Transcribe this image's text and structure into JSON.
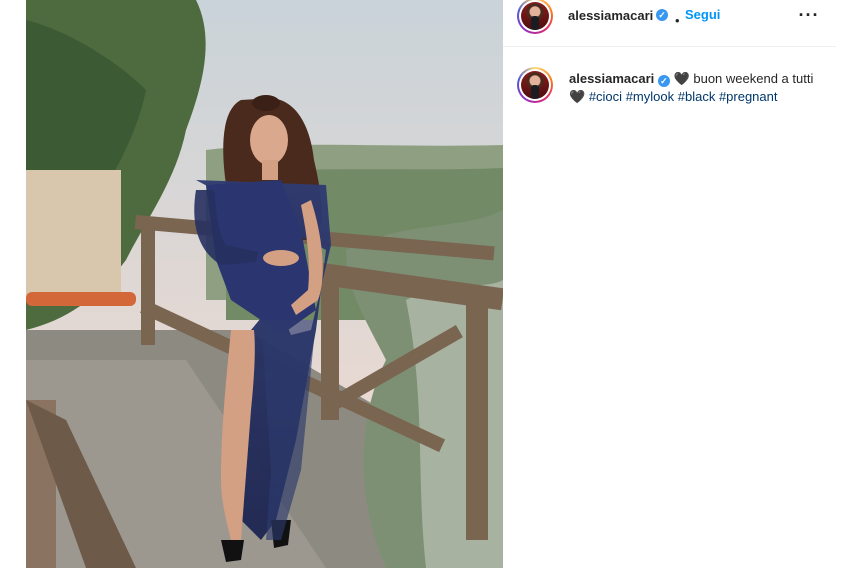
{
  "post": {
    "photo_alt": ""
  },
  "header": {
    "username": "alessiamacari",
    "separator": "•",
    "follow_label": "Segui",
    "more_label": "···"
  },
  "caption": {
    "username": "alessiamacari",
    "text_before": "buon weekend a tutti",
    "heart1": "🖤",
    "heart2": "🖤",
    "hashtags": [
      "#cioci",
      "#mylook",
      "#black",
      "#pregnant"
    ]
  },
  "icons": {
    "verified": "verified-badge-icon",
    "more": "more-options-icon"
  },
  "colors": {
    "follow": "#0095f6",
    "hashtag": "#00376b",
    "verified": "#3897f0"
  }
}
